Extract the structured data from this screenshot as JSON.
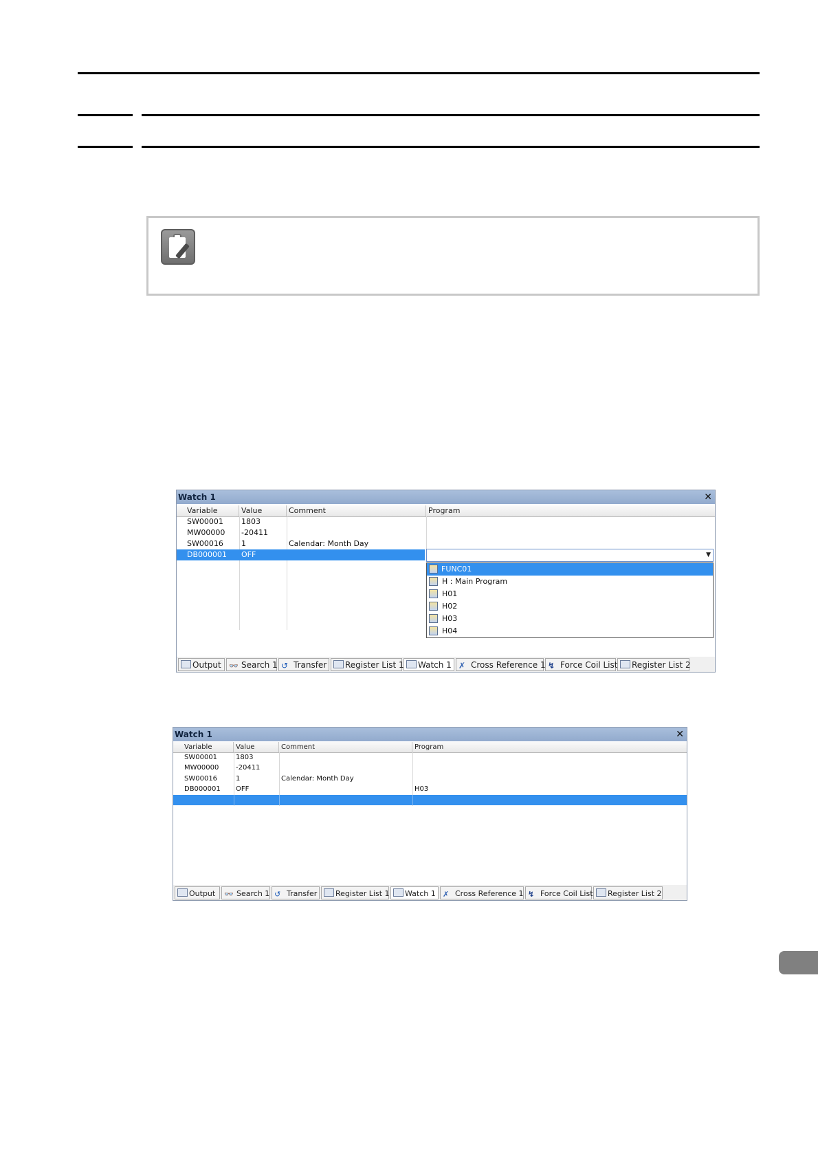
{
  "watch_window_1": {
    "title": "Watch 1",
    "close_glyph": "✕",
    "columns": [
      "Variable",
      "Value",
      "Comment",
      "Program"
    ],
    "rows": [
      {
        "variable": "SW00001",
        "value": "1803",
        "comment": "",
        "program": ""
      },
      {
        "variable": "MW00000",
        "value": "-20411",
        "comment": "",
        "program": ""
      },
      {
        "variable": "SW00016",
        "value": "1",
        "comment": "Calendar: Month Day",
        "program": ""
      },
      {
        "variable": "DB000001",
        "value": "OFF",
        "comment": "",
        "program": ""
      }
    ],
    "dropdown_arrow": "▼",
    "dropdown_items": [
      "FUNC01",
      "H : Main Program",
      "H01",
      "H02",
      "H03",
      "H04"
    ],
    "dropdown_selected": "FUNC01"
  },
  "watch_window_2": {
    "title": "Watch 1",
    "close_glyph": "✕",
    "columns": [
      "Variable",
      "Value",
      "Comment",
      "Program"
    ],
    "rows": [
      {
        "variable": "SW00001",
        "value": "1803",
        "comment": "",
        "program": ""
      },
      {
        "variable": "MW00000",
        "value": "-20411",
        "comment": "",
        "program": ""
      },
      {
        "variable": "SW00016",
        "value": "1",
        "comment": "Calendar: Month Day",
        "program": ""
      },
      {
        "variable": "DB000001",
        "value": "OFF",
        "comment": "",
        "program": "H03"
      }
    ]
  },
  "bottom_tabs": [
    {
      "label": "Output",
      "icon": "output-icon"
    },
    {
      "label": "Search 1",
      "icon": "binoculars-icon"
    },
    {
      "label": "Transfer",
      "icon": "transfer-icon"
    },
    {
      "label": "Register List 1",
      "icon": "register-list-icon"
    },
    {
      "label": "Watch 1",
      "icon": "watch-icon"
    },
    {
      "label": "Cross Reference 1",
      "icon": "cross-reference-icon"
    },
    {
      "label": "Force Coil List",
      "icon": "force-coil-icon"
    },
    {
      "label": "Register List 2",
      "icon": "register-list-icon"
    }
  ],
  "colors": {
    "title_bar": "#a9bfdc",
    "selection": "#3390ee",
    "side_tab": "#808080"
  }
}
